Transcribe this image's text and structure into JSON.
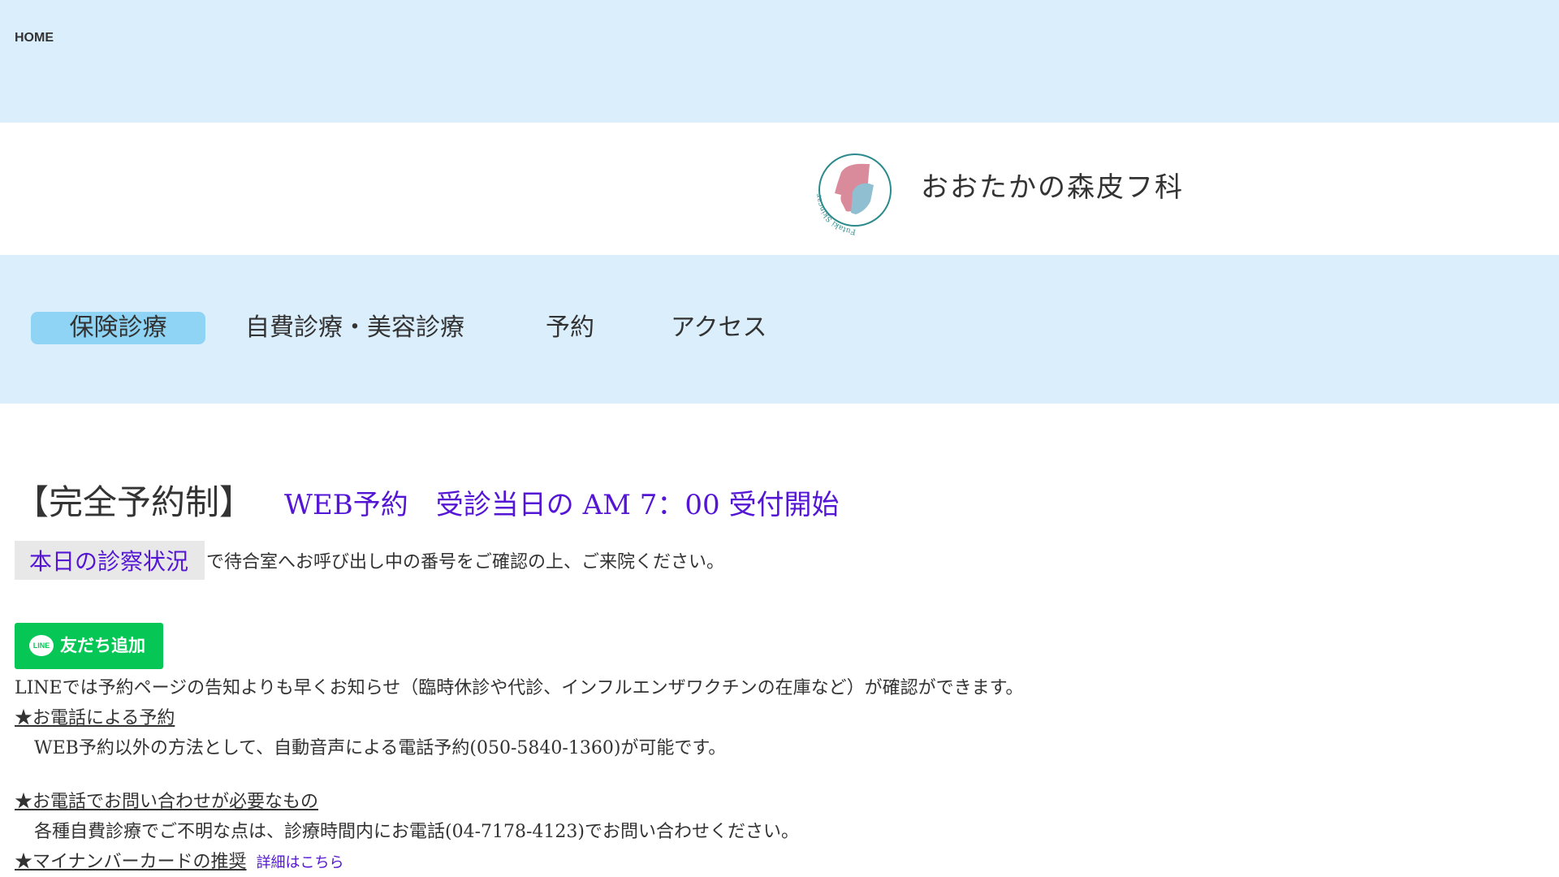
{
  "topbar": {
    "home_label": "HOME"
  },
  "logo": {
    "clinic_name": "おおたかの森皮フ科",
    "mark_text": "Futaki Skincare Clinic"
  },
  "nav": {
    "items": [
      {
        "label": "保険診療",
        "active": true
      },
      {
        "label": "自費診療・美容診療"
      },
      {
        "label": "予約"
      },
      {
        "label": "アクセス"
      }
    ]
  },
  "main": {
    "headline_bracket": "【完全予約制】",
    "headline_web": "WEB予約　受診当日の AM 7：00 受付開始",
    "status_button": "本日の診察状況",
    "status_text": "で待合室へお呼び出し中の番号をご確認の上、ご来院ください。",
    "line_button": "友だち追加",
    "line_badge": "LINE",
    "line_notice": "LINEでは予約ページの告知よりも早くお知らせ（臨時休診や代診、インフルエンザワクチンの在庫など）が確認ができます。",
    "phone_reservation_link": "★お電話による予約",
    "phone_reservation_text": "WEB予約以外の方法として、自動音声による電話予約(050-5840-1360)が可能です。",
    "phone_inquiry_link": "★お電話でお問い合わせが必要なもの",
    "phone_inquiry_text": "各種自費診療でご不明な点は、診療時間内にお電話(04-7178-4123)でお問い合わせください。",
    "mynumber_link": "★マイナンバーカードの推奨",
    "mynumber_detail": "詳細はこちら"
  },
  "colors": {
    "nav_bg": "#dbeefc",
    "nav_active": "#8fd4f5",
    "accent_purple": "#5416d4",
    "line_green": "#06c755"
  }
}
